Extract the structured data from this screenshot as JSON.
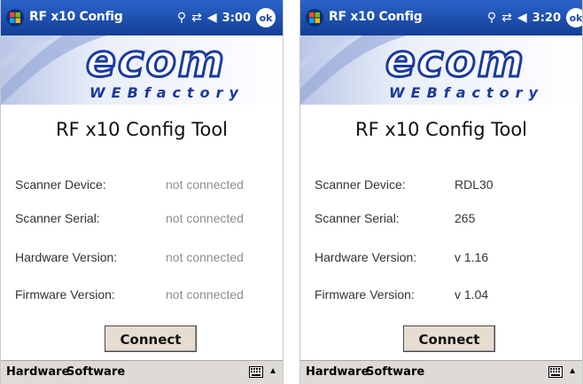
{
  "screens": [
    {
      "title": "RF x10 Config",
      "time": "3:00",
      "ok_label": "ok",
      "logo_text": "ecom",
      "logo_subtext": "WEBfactory",
      "app_title": "RF x10 Config Tool",
      "fields": [
        {
          "label": "Scanner Device:",
          "value": "not connected"
        },
        {
          "label": "Scanner Serial:",
          "value": "not connected"
        },
        {
          "label": "Hardware Version:",
          "value": "not connected"
        },
        {
          "label": "Firmware Version:",
          "value": "not connected"
        }
      ],
      "connect_label": "Connect",
      "menu": [
        "Hardware",
        "Software"
      ]
    },
    {
      "title": "RF x10 Config",
      "time": "3:20",
      "ok_label": "ok",
      "logo_text": "ecom",
      "logo_subtext": "WEBfactory",
      "app_title": "RF x10 Config Tool",
      "fields": [
        {
          "label": "Scanner Device:",
          "value": "RDL30"
        },
        {
          "label": "Scanner Serial:",
          "value": "265"
        },
        {
          "label": "Hardware Version:",
          "value": "v 1.16"
        },
        {
          "label": "Firmware Version:",
          "value": "v 1.04"
        }
      ],
      "connect_label": "Connect",
      "menu": [
        "Hardware",
        "Software"
      ]
    }
  ],
  "colors": {
    "titlebar": "#1c4aa6",
    "logo_blue": "#1a3a9e",
    "disconnected_value": "#8e8e8e",
    "connect_button": "#e6dcd0"
  },
  "icons": [
    "windows-start-icon",
    "antenna-icon",
    "connectivity-icon",
    "speaker-icon",
    "keyboard-icon",
    "sip-arrow-icon"
  ]
}
